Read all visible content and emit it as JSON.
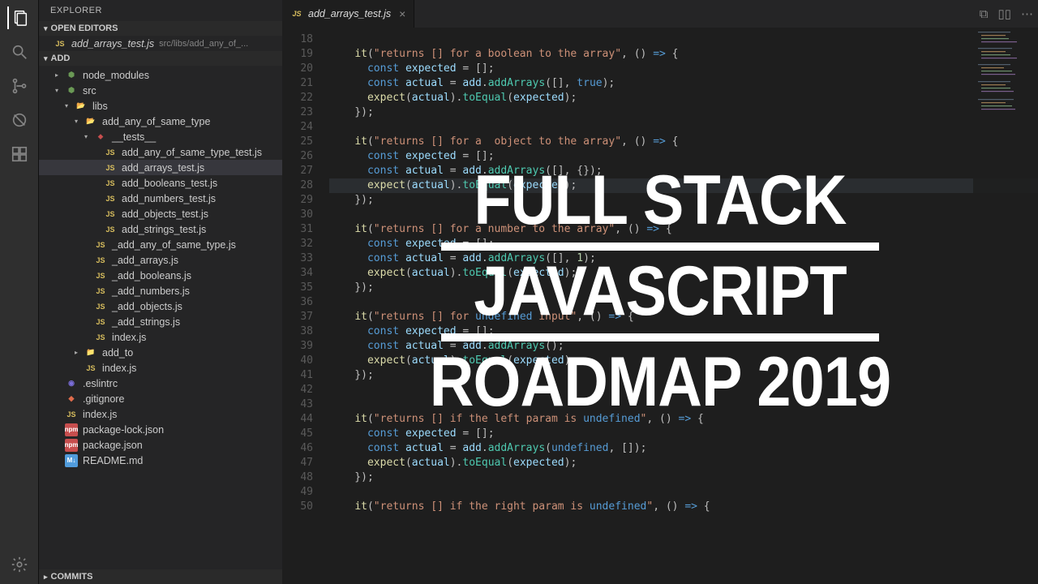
{
  "sidebar": {
    "title": "EXPLORER",
    "sections": {
      "openEditors": "OPEN EDITORS",
      "root": "ADD",
      "commits": "COMMITS"
    },
    "openFile": {
      "name": "add_arrays_test.js",
      "path": "src/libs/add_any_of_..."
    }
  },
  "tree": [
    {
      "indent": 1,
      "chev": "closed",
      "icon": "green",
      "name": "node_modules"
    },
    {
      "indent": 1,
      "chev": "open",
      "icon": "green",
      "name": "src"
    },
    {
      "indent": 2,
      "chev": "open",
      "icon": "folder-open",
      "name": "libs"
    },
    {
      "indent": 3,
      "chev": "open",
      "icon": "folder-open",
      "name": "add_any_of_same_type"
    },
    {
      "indent": 4,
      "chev": "open",
      "icon": "red",
      "name": "__tests__"
    },
    {
      "indent": 5,
      "chev": "none",
      "icon": "js",
      "name": "add_any_of_same_type_test.js"
    },
    {
      "indent": 5,
      "chev": "none",
      "icon": "js",
      "name": "add_arrays_test.js",
      "active": true
    },
    {
      "indent": 5,
      "chev": "none",
      "icon": "js",
      "name": "add_booleans_test.js"
    },
    {
      "indent": 5,
      "chev": "none",
      "icon": "js",
      "name": "add_numbers_test.js"
    },
    {
      "indent": 5,
      "chev": "none",
      "icon": "js",
      "name": "add_objects_test.js"
    },
    {
      "indent": 5,
      "chev": "none",
      "icon": "js",
      "name": "add_strings_test.js"
    },
    {
      "indent": 4,
      "chev": "none",
      "icon": "js",
      "name": "_add_any_of_same_type.js"
    },
    {
      "indent": 4,
      "chev": "none",
      "icon": "js",
      "name": "_add_arrays.js"
    },
    {
      "indent": 4,
      "chev": "none",
      "icon": "js",
      "name": "_add_booleans.js"
    },
    {
      "indent": 4,
      "chev": "none",
      "icon": "js",
      "name": "_add_numbers.js"
    },
    {
      "indent": 4,
      "chev": "none",
      "icon": "js",
      "name": "_add_objects.js"
    },
    {
      "indent": 4,
      "chev": "none",
      "icon": "js",
      "name": "_add_strings.js"
    },
    {
      "indent": 4,
      "chev": "none",
      "icon": "js",
      "name": "index.js"
    },
    {
      "indent": 3,
      "chev": "closed",
      "icon": "folder",
      "name": "add_to"
    },
    {
      "indent": 3,
      "chev": "none",
      "icon": "js",
      "name": "index.js"
    },
    {
      "indent": 1,
      "chev": "none",
      "icon": "eslint",
      "name": ".eslintrc"
    },
    {
      "indent": 1,
      "chev": "none",
      "icon": "git",
      "name": ".gitignore"
    },
    {
      "indent": 1,
      "chev": "none",
      "icon": "js",
      "name": "index.js"
    },
    {
      "indent": 1,
      "chev": "none",
      "icon": "npm",
      "name": "package-lock.json"
    },
    {
      "indent": 1,
      "chev": "none",
      "icon": "npm",
      "name": "package.json"
    },
    {
      "indent": 1,
      "chev": "none",
      "icon": "md",
      "name": "README.md"
    }
  ],
  "tab": {
    "icon": "JS",
    "name": "add_arrays_test.js"
  },
  "code": {
    "start": 18,
    "lines": [
      "",
      "    it(\"returns [] for a boolean to the array\", () => {",
      "      const expected = [];",
      "      const actual = add.addArrays([], true);",
      "      expect(actual).toEqual(expected);",
      "    });",
      "",
      "    it(\"returns [] for a  object to the array\", () => {",
      "      const expected = [];",
      "      const actual = add.addArrays([], {});",
      "      expect(actual).toEqual(expected);",
      "    });",
      "",
      "    it(\"returns [] for a number to the array\", () => {",
      "      const expected = [];",
      "      const actual = add.addArrays([], 1);",
      "      expect(actual).toEqual(expected);",
      "    });",
      "",
      "    it(\"returns [] for undefined input\", () => {",
      "      const expected = [];",
      "      const actual = add.addArrays();",
      "      expect(actual).toEqual(expected);",
      "    });",
      "",
      "",
      "    it(\"returns [] if the left param is undefined\", () => {",
      "      const expected = [];",
      "      const actual = add.addArrays(undefined, []);",
      "      expect(actual).toEqual(expected);",
      "    });",
      "",
      "    it(\"returns [] if the right param is undefined\", () => {"
    ]
  },
  "overlay": {
    "l1": "FULL STACK",
    "l2": "JAVASCRIPT",
    "l3": "ROADMAP 2019"
  }
}
